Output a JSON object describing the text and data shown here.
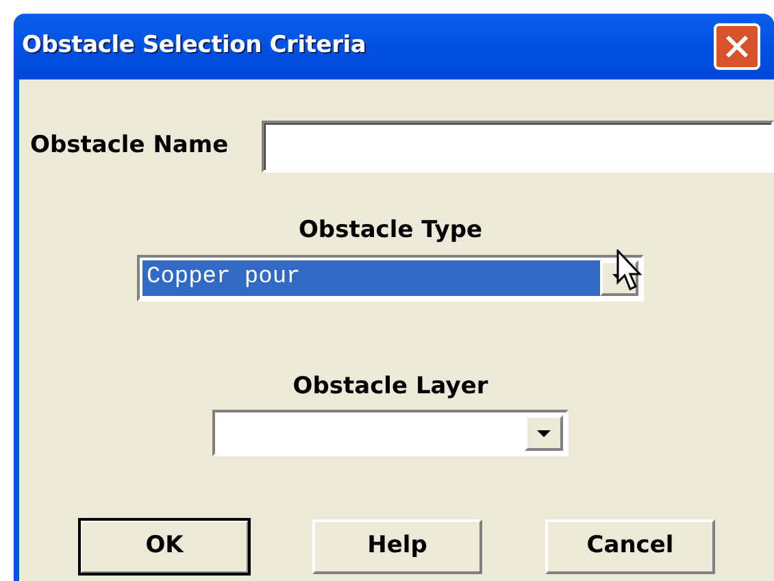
{
  "window": {
    "title": "Obstacle Selection Criteria"
  },
  "name_field": {
    "label": "Obstacle Name"
  },
  "type_combo": {
    "label": "Obstacle Type",
    "value": "Copper pour",
    "selected": true
  },
  "layer_combo": {
    "label": "Obstacle Layer",
    "selected": false
  },
  "buttons": [
    {
      "label": "OK",
      "default": true
    },
    {
      "label": "Help",
      "default": false
    },
    {
      "label": "Cancel",
      "default": false
    }
  ]
}
